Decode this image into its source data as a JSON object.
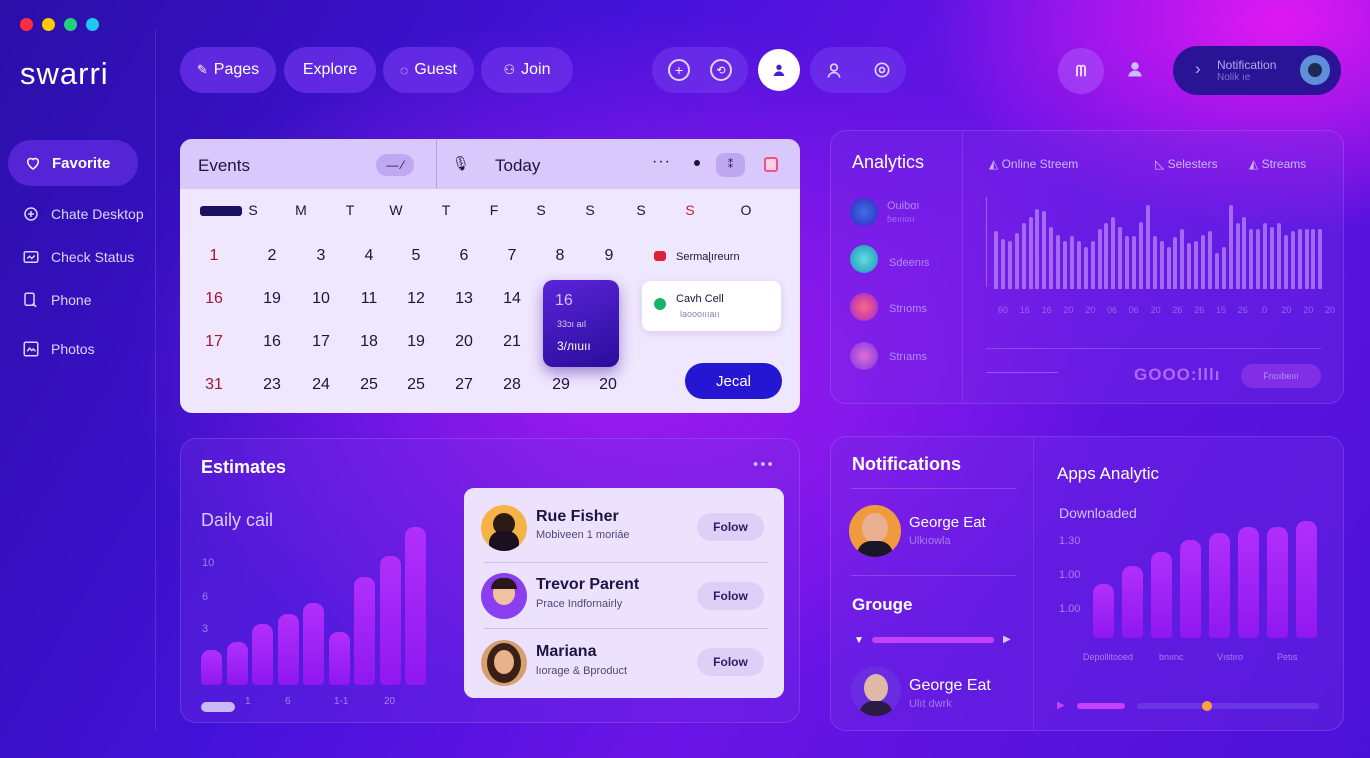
{
  "window": {
    "dots": [
      "#ff2d3f",
      "#ffcc00",
      "#22d27a",
      "#1ec8f0"
    ]
  },
  "app": {
    "title": "swarri"
  },
  "sidebar": {
    "items": [
      {
        "label": "Favorite",
        "icon": "heart-icon"
      },
      {
        "label": "Chate Desktop",
        "icon": "chat-icon"
      },
      {
        "label": "Check Status",
        "icon": "status-icon"
      },
      {
        "label": "Phone",
        "icon": "phone-icon"
      },
      {
        "label": "Photos",
        "icon": "photos-icon"
      }
    ]
  },
  "nav": {
    "pages": "Pages",
    "explore": "Explore",
    "guest": "Guest",
    "join": "Join"
  },
  "notification": {
    "title": "Notification",
    "sub": "Nolik ıe"
  },
  "calendar": {
    "title": "Events",
    "today": "Today",
    "weekdays": [
      "S",
      "M",
      "T",
      "W",
      "T",
      "F",
      "S",
      "S",
      "S",
      "S",
      "O"
    ],
    "rows": [
      {
        "first": "1",
        "days": [
          "2",
          "3",
          "4",
          "5",
          "6",
          "7",
          "8",
          "9"
        ]
      },
      {
        "first": "16",
        "days": [
          "19",
          "10",
          "11",
          "12",
          "13",
          "14"
        ]
      },
      {
        "first": "17",
        "days": [
          "16",
          "17",
          "18",
          "19",
          "20",
          "21"
        ]
      },
      {
        "first": "31",
        "days": [
          "23",
          "24",
          "25",
          "25",
          "27",
          "28",
          "29",
          "20"
        ]
      }
    ],
    "selected": {
      "day": "16",
      "line1": "33ɔı aıl",
      "line2": "3/лıuıı"
    },
    "event1": "Sermaɭıreurn",
    "event2": {
      "title": "Cavh Cell",
      "sub": "laoooıııaıı"
    },
    "button": "Jecal"
  },
  "analytics": {
    "title": "Analytics",
    "tabs": [
      "Online Streem",
      "Selesters",
      "Streams"
    ],
    "items": [
      {
        "label": "Ouibɑı",
        "sub": "ɓeıııoıı"
      },
      {
        "label": "Sdeenıs",
        "sub": ""
      },
      {
        "label": "Strıoms",
        "sub": ""
      },
      {
        "label": "Strıams",
        "sub": ""
      }
    ],
    "ticks": [
      "60",
      "16",
      "16",
      "20",
      "20",
      "06",
      "06",
      "20",
      "26",
      "26",
      "15",
      "26",
      ".0",
      "20",
      "20",
      "20"
    ],
    "footer": "GOOO:lllı",
    "footer_btn": "Fnoıbeııı",
    "bars": [
      0.48,
      0.42,
      0.4,
      0.47,
      0.55,
      0.6,
      0.67,
      0.65,
      0.52,
      0.45,
      0.4,
      0.44,
      0.4,
      0.35,
      0.4,
      0.5,
      0.55,
      0.6,
      0.52,
      0.44,
      0.44,
      0.56,
      0.7,
      0.44,
      0.4,
      0.35,
      0.43,
      0.5,
      0.38,
      0.4,
      0.45,
      0.48,
      0.3,
      0.35,
      0.7,
      0.55,
      0.6,
      0.5,
      0.5,
      0.55,
      0.52,
      0.55,
      0.45,
      0.48,
      0.5,
      0.5,
      0.5,
      0.5
    ]
  },
  "estimates": {
    "title": "Estimates",
    "subtitle": "Daily cail",
    "yticks": [
      "10",
      "6",
      "3"
    ],
    "xticks": [
      "1",
      "6",
      "1-1",
      "20"
    ],
    "bars": [
      0.22,
      0.27,
      0.38,
      0.44,
      0.51,
      0.33,
      0.67,
      0.8,
      0.98
    ]
  },
  "people": [
    {
      "name": "Rue Fisher",
      "sub": "Mobiveen 1 moriáe",
      "action": "Folow"
    },
    {
      "name": "Trevor Parent",
      "sub": "Prace Indfornairly",
      "action": "Folow"
    },
    {
      "name": "Mariana",
      "sub": "lıorage &  Bproduct",
      "action": "Folow"
    }
  ],
  "notifications": {
    "title": "Notifications",
    "user1": {
      "name": "George Eat",
      "sub": "Ulkıowla"
    },
    "group_title": "Grouge",
    "user2": {
      "name": "George Eat",
      "sub": "Ulıt dwrk"
    }
  },
  "apps": {
    "title": "Apps Analytic",
    "subtitle": "Downloaded",
    "yticks": [
      "1.30",
      "1.00",
      "1.00"
    ],
    "xticks": [
      "Depollitooed",
      "bnıınc",
      "Vıstıro",
      "Petıs"
    ],
    "bars": [
      0.43,
      0.57,
      0.68,
      0.78,
      0.83,
      0.88,
      0.88,
      0.93
    ]
  }
}
